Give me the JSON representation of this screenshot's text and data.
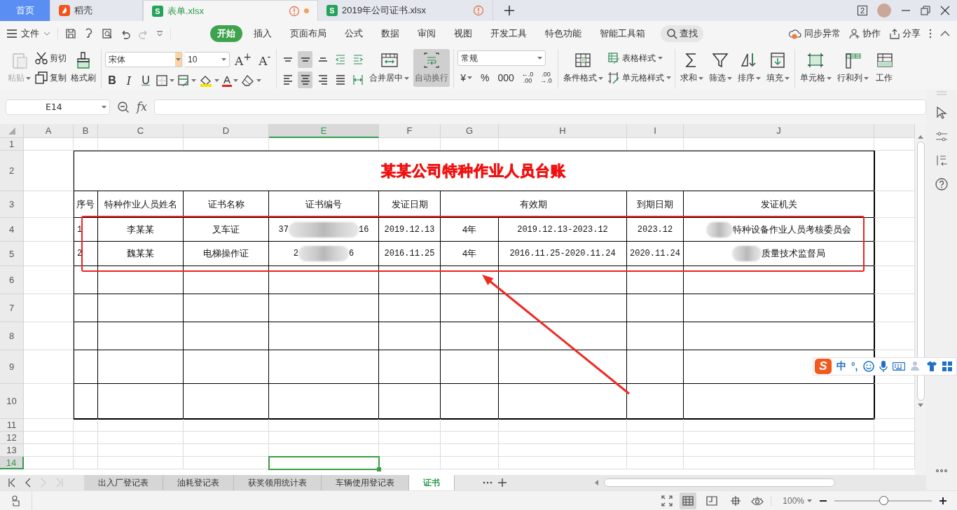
{
  "tabs": [
    {
      "label": "首页",
      "kind": "home",
      "selected": false,
      "unsaved": false
    },
    {
      "label": "稻壳",
      "kind": "docer",
      "selected": false,
      "unsaved": false
    },
    {
      "label": "表单.xlsx",
      "kind": "file",
      "badge": "S",
      "selected": true,
      "unsaved": true
    },
    {
      "label": "2019年公司证书.xlsx",
      "kind": "file",
      "badge": "S",
      "selected": false,
      "unsaved": false
    }
  ],
  "window": {
    "count": "2"
  },
  "menu": {
    "file": "文件",
    "tabs": [
      {
        "label": "开始",
        "selected": true
      },
      {
        "label": "插入",
        "selected": false
      },
      {
        "label": "页面布局",
        "selected": false
      },
      {
        "label": "公式",
        "selected": false
      },
      {
        "label": "数据",
        "selected": false
      },
      {
        "label": "审阅",
        "selected": false
      },
      {
        "label": "视图",
        "selected": false
      },
      {
        "label": "开发工具",
        "selected": false
      },
      {
        "label": "特色功能",
        "selected": false
      },
      {
        "label": "智能工具箱",
        "selected": false
      }
    ],
    "search": "查找",
    "actions": [
      "同步异常",
      "协作",
      "分享"
    ]
  },
  "ribbon": {
    "paste": {
      "label": "粘贴",
      "disabled": true
    },
    "clip": [
      "剪切",
      "复制"
    ],
    "painter": "格式刷",
    "font": {
      "name": "宋体",
      "size": "10"
    },
    "size_buttons": [
      "A$^{+}$",
      "A$^{-}$"
    ],
    "style_buttons": [
      "B",
      "I",
      "U"
    ],
    "font_color": "A",
    "align_buttons": [
      {
        "selected": false
      },
      {
        "selected": true
      },
      {
        "selected": false
      },
      {
        "selected": false
      },
      {
        "selected": false
      },
      {
        "selected": false
      },
      {
        "selected": true
      },
      {
        "selected": false
      },
      {
        "selected": false
      },
      {
        "selected": false
      }
    ],
    "merge": "合并居中",
    "wrap": {
      "label": "自动换行",
      "selected": true
    },
    "number_format": "常规",
    "number_buttons": [
      {
        "label": "¥",
        "dropdown": true
      },
      {
        "label": "%",
        "dropdown": false
      },
      {
        "label": "000",
        "dropdown": false
      }
    ],
    "decimal_buttons": [
      {
        "top": "←.0",
        "bottom": ".00"
      },
      {
        "top": ".00",
        "bottom": "→.0"
      }
    ],
    "conditional": "条件格式",
    "styles": [
      "表格样式",
      "单元格样式"
    ],
    "editing": [
      "求和",
      "筛选",
      "排序",
      "填充"
    ],
    "cells": [
      "单元格",
      "行和列",
      "工作"
    ]
  },
  "formula_bar": {
    "name_box": "E14",
    "fx": "fx"
  },
  "sheet": {
    "columns": [
      {
        "label": "A",
        "selected": false
      },
      {
        "label": "B",
        "selected": false
      },
      {
        "label": "C",
        "selected": false
      },
      {
        "label": "D",
        "selected": false
      },
      {
        "label": "E",
        "selected": true
      },
      {
        "label": "F",
        "selected": false
      },
      {
        "label": "G",
        "selected": false
      },
      {
        "label": "H",
        "selected": false
      },
      {
        "label": "I",
        "selected": false
      },
      {
        "label": "J",
        "selected": false
      }
    ],
    "rows": [
      {
        "label": "1",
        "selected": false
      },
      {
        "label": "2",
        "selected": false
      },
      {
        "label": "3",
        "selected": false
      },
      {
        "label": "4",
        "selected": false
      },
      {
        "label": "5",
        "selected": false
      },
      {
        "label": "6",
        "selected": false
      },
      {
        "label": "7",
        "selected": false
      },
      {
        "label": "8",
        "selected": false
      },
      {
        "label": "9",
        "selected": false
      },
      {
        "label": "10",
        "selected": false
      },
      {
        "label": "11",
        "selected": false
      },
      {
        "label": "12",
        "selected": false
      },
      {
        "label": "13",
        "selected": false
      },
      {
        "label": "14",
        "selected": true
      }
    ],
    "title": "某某公司特种作业人员台账",
    "headers": [
      "序号",
      "特种作业人员姓名",
      "证书名称",
      "证书编号",
      "发证日期",
      "有效期",
      "到期日期",
      "发证机关"
    ],
    "records": [
      {
        "no": "1",
        "name": "李某某",
        "cert": "叉车证",
        "number": [
          "37",
          "16"
        ],
        "issue": "2019.12.13",
        "term": "4年",
        "validity": "2019.12.13-2023.12",
        "expiry": "2023.12",
        "authority": "特种设备作业人员考核委员会"
      },
      {
        "no": "2",
        "name": "魏某某",
        "cert": "电梯操作证",
        "number": [
          "2",
          "6"
        ],
        "issue": "2016.11.25",
        "term": "4年",
        "validity": "2016.11.25-2020.11.24",
        "expiry": "2020.11.24",
        "authority": "质量技术监督局"
      }
    ]
  },
  "sheet_tabs": [
    {
      "label": "出入厂登记表",
      "selected": false
    },
    {
      "label": "油耗登记表",
      "selected": false
    },
    {
      "label": "获奖领用统计表",
      "selected": false
    },
    {
      "label": "车辆使用登记表",
      "selected": false
    },
    {
      "label": "证书",
      "selected": true
    }
  ],
  "ime": {
    "logo": "S",
    "mode": "中",
    "punct": "°,"
  },
  "status": {
    "zoom": "100%",
    "zoom_slider": {
      "level": 0.5
    }
  }
}
